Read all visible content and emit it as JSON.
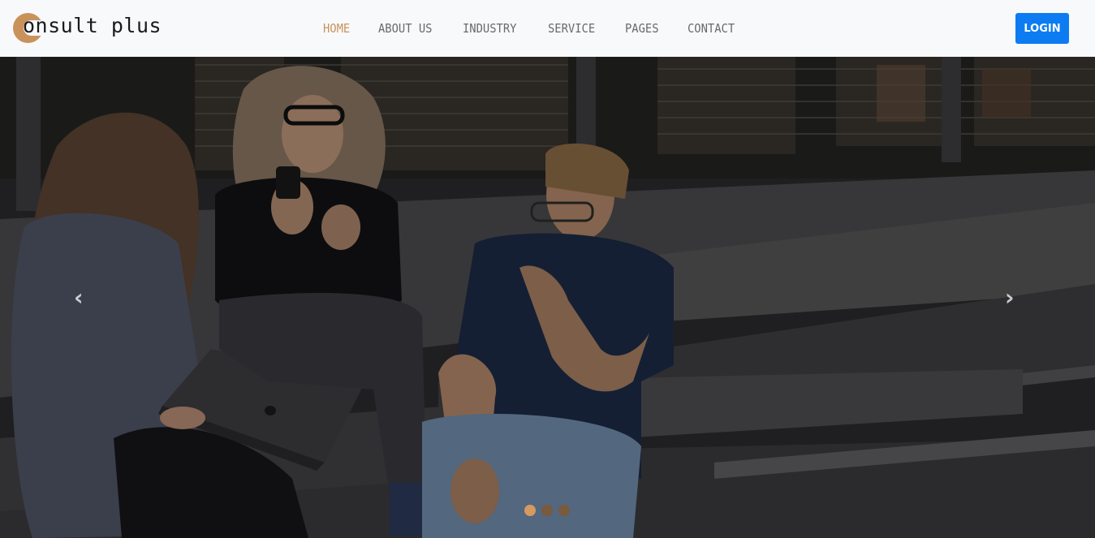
{
  "brand": {
    "logo_text": "onsult plus",
    "accent": "#c9925a"
  },
  "nav": {
    "items": [
      {
        "label": "HOME",
        "active": true
      },
      {
        "label": "ABOUT US",
        "active": false
      },
      {
        "label": "INDUSTRY",
        "active": false
      },
      {
        "label": "SERVICE",
        "active": false
      },
      {
        "label": "PAGES",
        "active": false
      },
      {
        "label": "CONTACT",
        "active": false
      }
    ]
  },
  "header": {
    "login_label": "LOGIN",
    "login_color": "#0d7cf2"
  },
  "carousel": {
    "prev_icon": "chevron-left-icon",
    "next_icon": "chevron-right-icon",
    "prev_glyph": "‹",
    "next_glyph": "›",
    "slide_count": 3,
    "active_index": 0
  }
}
